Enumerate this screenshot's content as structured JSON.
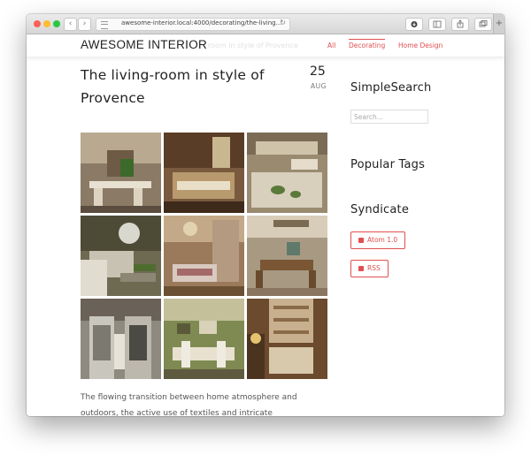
{
  "browser": {
    "url": "awesome-interior.local:4000/decorating/the-living...",
    "back": "‹",
    "forward": "›",
    "reload": "↻"
  },
  "site": {
    "brand": "AWESOME INTERIOR",
    "ghost_title": "room in style of Provence",
    "nav": [
      "All",
      "Decorating",
      "Home Design"
    ]
  },
  "post": {
    "title": "The living-room in style of Provence",
    "date_day": "25",
    "date_month": "AUG",
    "body": "The flowing transition between home atmosphere and outdoors, the active use of textiles and intricate ornaments, the pretty detailing – these are the most"
  },
  "sidebar": {
    "search_heading": "SimpleSearch",
    "search_placeholder": "Search...",
    "tags_heading": "Popular Tags",
    "syndicate_heading": "Syndicate",
    "feeds": [
      "Atom 1.0",
      "RSS"
    ]
  },
  "gallery_images": [
    "dining-room-photo",
    "kitchen-table-photo",
    "sink-dish-rack-photo",
    "living-room-sofa-photo",
    "dining-chandelier-photo",
    "rustic-dining-photo",
    "french-doors-photo",
    "green-dining-room-photo",
    "kitchen-cabinets-photo"
  ],
  "colors": {
    "accent": "#e0504f",
    "text": "#222222"
  }
}
